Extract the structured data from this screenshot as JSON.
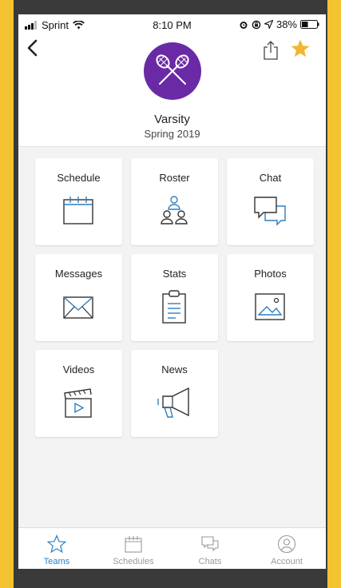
{
  "status": {
    "carrier": "Sprint",
    "time": "8:10 PM",
    "battery": "38%"
  },
  "header": {
    "team_name": "Varsity",
    "season": "Spring 2019"
  },
  "tiles": [
    {
      "label": "Schedule",
      "icon": "calendar-icon"
    },
    {
      "label": "Roster",
      "icon": "people-icon"
    },
    {
      "label": "Chat",
      "icon": "chat-bubbles-icon"
    },
    {
      "label": "Messages",
      "icon": "envelope-icon"
    },
    {
      "label": "Stats",
      "icon": "clipboard-icon"
    },
    {
      "label": "Photos",
      "icon": "image-icon"
    },
    {
      "label": "Videos",
      "icon": "clapperboard-icon"
    },
    {
      "label": "News",
      "icon": "megaphone-icon"
    }
  ],
  "tabs": [
    {
      "label": "Teams",
      "icon": "star-outline-icon",
      "active": true
    },
    {
      "label": "Schedules",
      "icon": "calendar-icon",
      "active": false
    },
    {
      "label": "Chats",
      "icon": "chat-bubbles-icon",
      "active": false
    },
    {
      "label": "Account",
      "icon": "user-circle-icon",
      "active": false
    }
  ],
  "colors": {
    "accent": "#2d7fc1",
    "team_logo": "#6a2aa6",
    "star": "#f2b632",
    "background": "#f3f3f3",
    "frame": "#f4c430"
  }
}
